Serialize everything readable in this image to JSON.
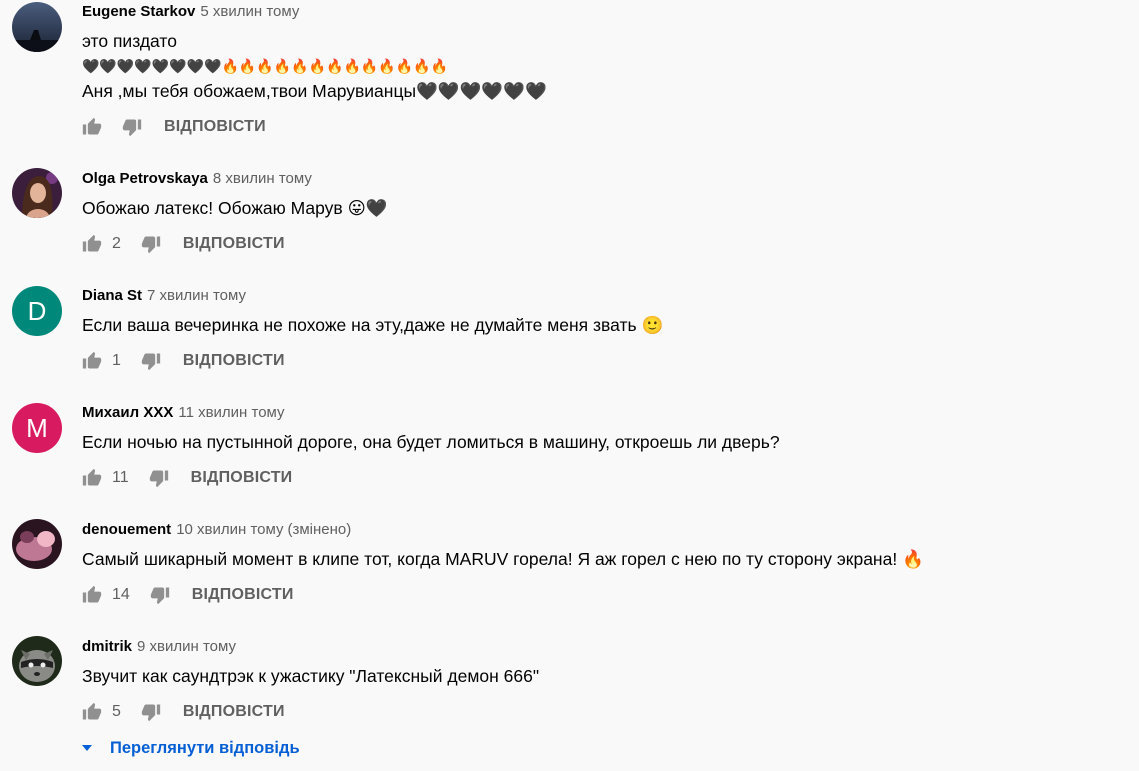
{
  "reply_label": "ВІДПОВІСТИ",
  "comments": [
    {
      "author": "Eugene Starkov",
      "time": "5 хвилин тому",
      "edited": "",
      "lines": [
        "это пиздато",
        "🖤🖤🖤🖤🖤🖤🖤🖤🔥🔥🔥🔥🔥🔥🔥🔥🔥🔥🔥🔥🔥",
        "Аня ,мы тебя обожаем,твои Марувианцы🖤🖤🖤🖤🖤🖤"
      ],
      "likes": "",
      "avatar": "photo-night-sky"
    },
    {
      "author": "Olga Petrovskaya",
      "time": "8 хвилин тому",
      "edited": "",
      "lines": [
        "Обожаю латекс! Обожаю Марув 😛🖤"
      ],
      "likes": "2",
      "avatar": "photo-woman"
    },
    {
      "author": "Diana St",
      "time": "7 хвилин тому",
      "edited": "",
      "lines": [
        "Если ваша вечеринка не похоже на эту,даже не думайте меня звать 🙂"
      ],
      "likes": "1",
      "avatar": "letter",
      "avatar_letter": "D",
      "avatar_color": "#00897b"
    },
    {
      "author": "Михаил ХХХ",
      "time": "11 хвилин тому",
      "edited": "",
      "lines": [
        "Если ночью на пустынной дороге, она будет ломиться в машину, откроешь ли дверь?"
      ],
      "likes": "11",
      "avatar": "letter",
      "avatar_letter": "M",
      "avatar_color": "#d81b60"
    },
    {
      "author": "denouement",
      "time": "10 хвилин тому",
      "edited": "(змінено)",
      "lines": [
        "Самый шикарный момент в клипе тот, когда MARUV горела! Я аж горел с нею по ту сторону экрана! 🔥"
      ],
      "likes": "14",
      "avatar": "photo-pink"
    },
    {
      "author": "dmitrik",
      "time": "9 хвилин тому",
      "edited": "",
      "lines": [
        "Звучит как саундтрэк к ужастику \"Латексный демон 666\""
      ],
      "likes": "5",
      "avatar": "photo-raccoon"
    }
  ],
  "view_replies": "Переглянути відповідь",
  "colors": {
    "link": "#065fd4",
    "meta": "#606060",
    "icon": "#909090"
  }
}
